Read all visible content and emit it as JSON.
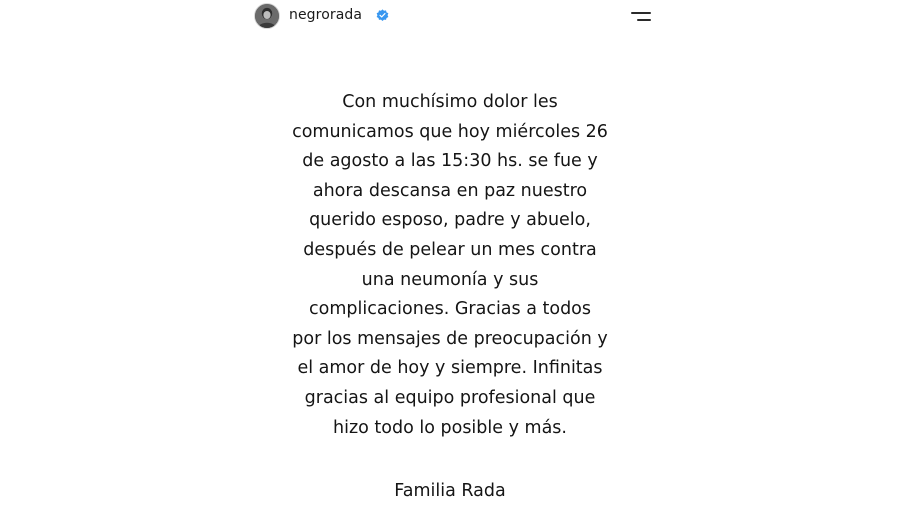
{
  "header": {
    "username": "negrorada",
    "verified": true,
    "avatar_icon": "profile-avatar",
    "menu_icon": "hamburger-menu-icon"
  },
  "post": {
    "message_lines": [
      "Con muchísimo dolor les",
      "comunicamos que hoy miércoles 26",
      "de agosto a las 15:30 hs. se fue y",
      "ahora descansa en paz nuestro",
      "querido esposo, padre y abuelo,",
      "después de pelear un mes contra",
      "una neumonía y sus",
      "complicaciones. Gracias a todos",
      "por los mensajes de preocupación y",
      "el amor de hoy y siempre. Infinitas",
      "gracias al equipo profesional que",
      "hizo todo lo posible y más."
    ],
    "signature": "Familia Rada"
  },
  "colors": {
    "background": "#ffffff",
    "text": "#151515",
    "verified_badge": "#3897f0"
  }
}
